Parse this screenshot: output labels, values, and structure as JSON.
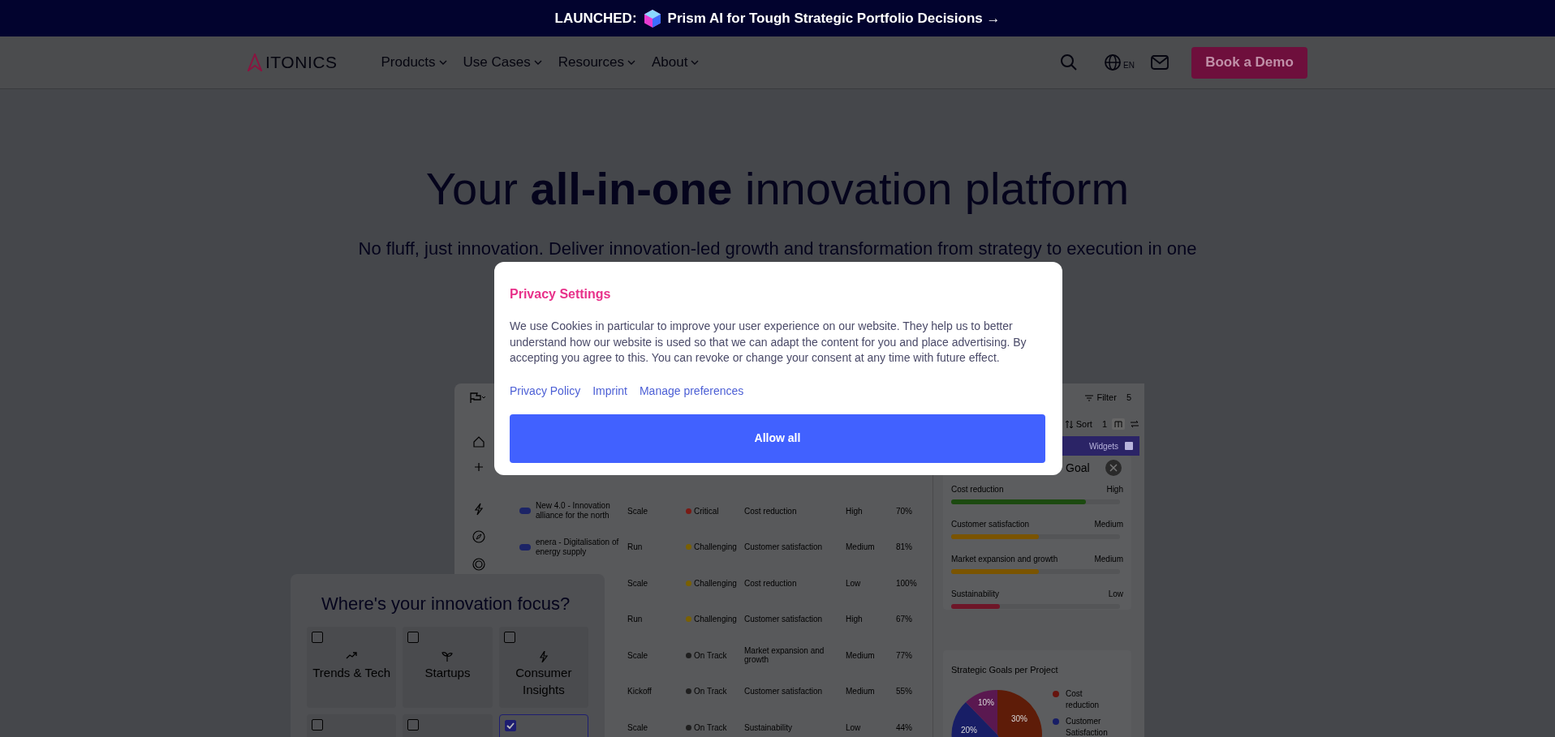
{
  "banner": {
    "label": "LAUNCHED:",
    "text": "Prism AI for Tough Strategic Portfolio Decisions →"
  },
  "nav": {
    "logo": "ITONICS",
    "menu": [
      "Products",
      "Use Cases",
      "Resources",
      "About"
    ],
    "language": "EN",
    "cta": "Book a Demo"
  },
  "hero": {
    "title": "Your **all-in-one** innovation platform",
    "subtitle": "No fluff, just innovation. Deliver innovation-led growth and transformation from strategy to execution in one"
  },
  "dashboard": {
    "filter": {
      "label": "Filter",
      "count": "5"
    },
    "sort": {
      "label": "Sort",
      "count": "1"
    },
    "rows": [
      {
        "name": "New 4.0 - Innovation alliance for the north",
        "phase": "Scale",
        "status": "Critical",
        "color": "#7a1a14",
        "goal": "Cost reduction",
        "priority": "High",
        "progress": "70%"
      },
      {
        "name": "enera - Digitalisation of energy supply",
        "phase": "Run",
        "status": "Challenging",
        "color": "#7a6000",
        "goal": "Customer satisfaction",
        "priority": "Medium",
        "progress": "81%"
      },
      {
        "phase": "Scale",
        "status": "Challenging",
        "color": "#7a6000",
        "goal": "Cost reduction",
        "priority": "Low",
        "progress": "100%"
      },
      {
        "phase": "Run",
        "status": "Challenging",
        "color": "#7a6000",
        "goal": "Customer satisfaction",
        "priority": "High",
        "progress": "67%"
      },
      {
        "phase": "Scale",
        "status": "On Track",
        "color": "#1f1f1f",
        "goal": "Market expansion and growth",
        "priority": "Medium",
        "progress": "77%"
      },
      {
        "phase": "Kickoff",
        "status": "On Track",
        "color": "#1f1f1f",
        "goal": "Customer satisfaction",
        "priority": "Medium",
        "progress": "55%"
      },
      {
        "phase": "Scale",
        "status": "On Track",
        "color": "#1f1f1f",
        "goal": "Sustainability",
        "priority": "Low",
        "progress": "44%"
      }
    ],
    "widgets": "Widgets",
    "goal_widget": {
      "title": "Goal",
      "goals": [
        {
          "name": "Cost reduction",
          "rating": "High",
          "level": 0.8,
          "color": "#1c4a10"
        },
        {
          "name": "Customer satisfaction",
          "rating": "Medium",
          "level": 0.52,
          "color": "#7a5400"
        },
        {
          "name": "Market expansion and growth",
          "rating": "Medium",
          "level": 0.52,
          "color": "#7a5400"
        },
        {
          "name": "Sustainability",
          "rating": "Low",
          "level": 0.29,
          "color": "#6e1628"
        }
      ]
    },
    "pie_widget": {
      "title": "Strategic Goals per Project",
      "slice_labels": [
        "10%",
        "30%",
        "20%"
      ],
      "legend": [
        {
          "label": "Cost reduction",
          "color": "#66140e"
        },
        {
          "label": "Customer Satisfaction",
          "color": "#181e66"
        }
      ]
    }
  },
  "focus": {
    "title": "Where's your innovation focus?",
    "tiles": [
      {
        "label": "Trends & Tech",
        "checked": false,
        "kind": "trend"
      },
      {
        "label": "Startups",
        "checked": false,
        "kind": "sprout"
      },
      {
        "label": "Consumer Insights",
        "checked": false,
        "kind": "bolt"
      },
      {
        "checked": false,
        "kind": "none"
      },
      {
        "checked": false,
        "kind": "none"
      },
      {
        "checked": true,
        "kind": "none"
      }
    ]
  },
  "cookie_dialog": {
    "title": "Privacy Settings",
    "text": "We use Cookies in particular to improve your user experience on our website. They help us to better understand how our website is used so that we can adapt the content for you and place advertising. By accepting you agree to this. You can revoke or change your consent at any time with future effect.",
    "links": [
      "Privacy Policy",
      "Imprint",
      "Manage preferences"
    ],
    "button": "Allow all"
  }
}
